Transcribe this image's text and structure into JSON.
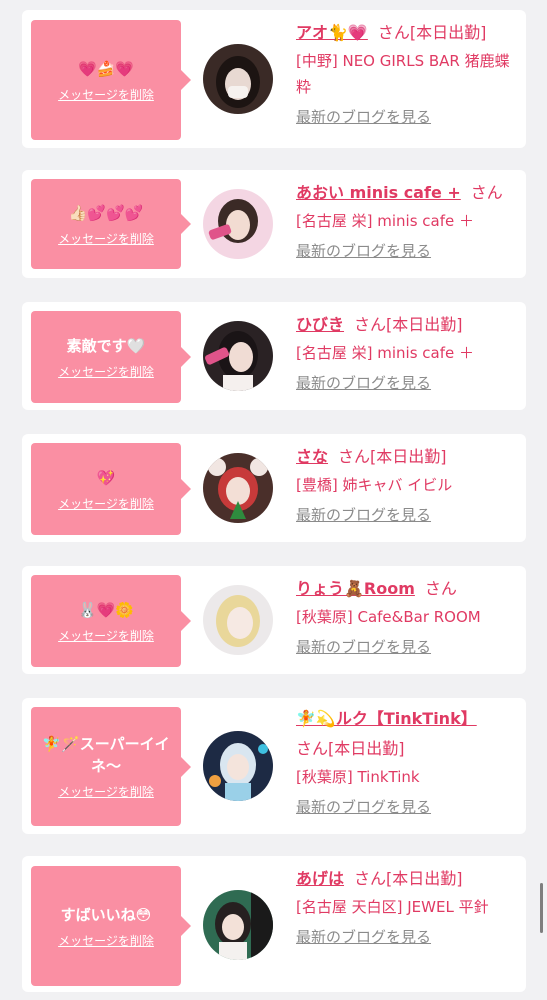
{
  "cards": [
    {
      "message": "💗🍰💗",
      "delete_label": "メッセージを削除",
      "name": "アオ🐈💗",
      "suffix": "さん[本日出勤]",
      "shop": "[中野] NEO GIRLS BAR 猪鹿蝶 粋",
      "blog_label": "最新のブログを見る"
    },
    {
      "message": "👍🏻💕💕💕",
      "delete_label": "メッセージを削除",
      "name": "あおい minis cafe +",
      "suffix": "さん",
      "shop": "[名古屋 栄] minis cafe ＋",
      "blog_label": "最新のブログを見る"
    },
    {
      "message": "素敵です🤍",
      "delete_label": "メッセージを削除",
      "name": "ひびき",
      "suffix": "さん[本日出勤]",
      "shop": "[名古屋 栄] minis cafe ＋",
      "blog_label": "最新のブログを見る"
    },
    {
      "message": "💖",
      "delete_label": "メッセージを削除",
      "name": "さな",
      "suffix": "さん[本日出勤]",
      "shop": "[豊橋] 姉キャバ イビル",
      "blog_label": "最新のブログを見る"
    },
    {
      "message": "🐰💗🌼",
      "delete_label": "メッセージを削除",
      "name": "りょう🧸Room",
      "suffix": "さん",
      "shop": "[秋葉原] Cafe&Bar ROOM",
      "blog_label": "最新のブログを見る"
    },
    {
      "message": "🧚🪄スーパーイイネ〜",
      "delete_label": "メッセージを削除",
      "name": "🧚💫ルク【TinkTink】",
      "suffix": "さん[本日出勤]",
      "shop": "[秋葉原] TinkTink",
      "blog_label": "最新のブログを見る"
    },
    {
      "message": "すばいいね😳",
      "delete_label": "メッセージを削除",
      "name": "あげは",
      "suffix": "さん[本日出勤]",
      "shop": "[名古屋 天白区] JEWEL 平針",
      "blog_label": "最新のブログを見る"
    }
  ],
  "colors": {
    "page_background": "#f1f1f3",
    "card_background": "#ffffff",
    "bubble": "#fa8fa3",
    "name_text": "#e03a63",
    "link_gray": "#8b8b8b"
  }
}
